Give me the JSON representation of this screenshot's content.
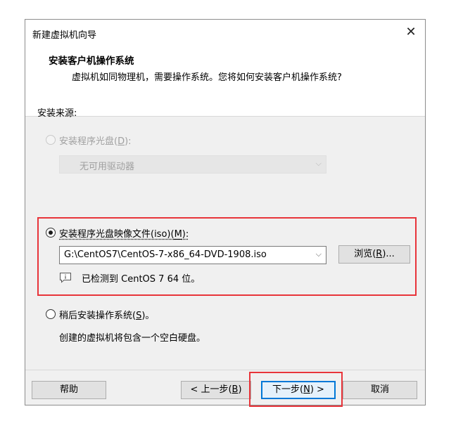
{
  "window": {
    "title": "新建虚拟机向导"
  },
  "header": {
    "title": "安装客户机操作系统",
    "subtitle": "虚拟机如同物理机，需要操作系统。您将如何安装客户机操作系统?"
  },
  "source_label": "安装来源:",
  "options": {
    "disc": {
      "label_pre": "安装程序光盘(",
      "key": "D",
      "label_post": "):",
      "selected": false,
      "enabled": false,
      "dropdown_value": "无可用驱动器"
    },
    "iso": {
      "label_pre": "安装程序光盘映像文件(iso)(",
      "key": "M",
      "label_post": "):",
      "selected": true,
      "enabled": true,
      "path_value": "G:\\CentOS7\\CentOS-7-x86_64-DVD-1908.iso",
      "browse_pre": "浏览(",
      "browse_key": "R",
      "browse_post": ")...",
      "detected": "已检测到 CentOS 7 64 位。"
    },
    "later": {
      "label_pre": "稍后安装操作系统(",
      "key": "S",
      "label_post": ")。",
      "selected": false,
      "enabled": true,
      "desc": "创建的虚拟机将包含一个空白硬盘。"
    }
  },
  "footer": {
    "help": "帮助",
    "back_pre": "< 上一步(",
    "back_key": "B",
    "back_post": ")",
    "next_pre": "下一步(",
    "next_key": "N",
    "next_post": ") >",
    "cancel": "取消"
  },
  "colors": {
    "highlight": "#e8343a",
    "focus": "#0078d7"
  },
  "icons": {
    "close": "close-icon",
    "chevron": "chevron-down-icon",
    "info": "info-comment-icon"
  }
}
